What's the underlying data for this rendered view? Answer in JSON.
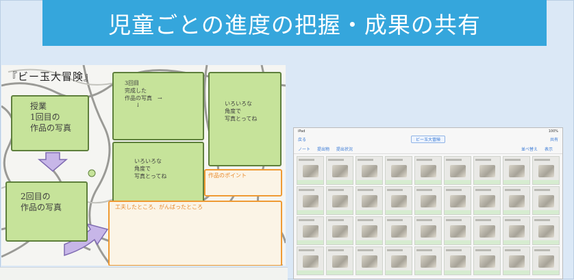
{
  "title": "児童ごとの進度の把握・成果の共有",
  "worksheet": {
    "title": "『ビー玉大冒険』",
    "box1": "授業\n1回目の\n作品の写真",
    "box2": "3回目\n完成した\n作品の写真　→\n　　↓",
    "box3": "いろいろな\n角度で\n写真とってね",
    "box4": "いろいろな\n角度で\n写真とってね",
    "box5": "2回目の\n作品の写真",
    "box6": "作品のポイント",
    "box7": "工夫したところ、がんばったところ"
  },
  "tablet": {
    "status_left": "iPad",
    "status_right": "100%",
    "nav_left": "戻る",
    "title": "ビー玉大冒険",
    "nav_right": "共有",
    "toolbar_left": [
      "ノート",
      "提出物",
      "提出状況"
    ],
    "toolbar_right": [
      "並べ替え",
      "表示"
    ],
    "thumbs": 36
  },
  "colors": {
    "banner": "#35a6dc",
    "background": "#dbe8f6",
    "green_box": "#c6e39a",
    "orange_box": "#ef9a33"
  }
}
